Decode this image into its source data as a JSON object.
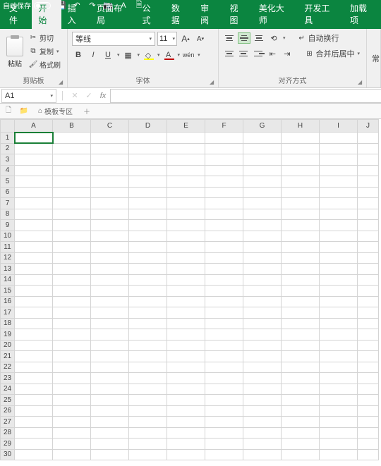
{
  "titlebar": {
    "autosave": "自动保存"
  },
  "tabs": [
    "文件",
    "开始",
    "插入",
    "页面布局",
    "公式",
    "数据",
    "审阅",
    "视图",
    "美化大师",
    "开发工具",
    "加载项"
  ],
  "active_tab": 1,
  "clipboard": {
    "paste": "粘贴",
    "cut": "剪切",
    "copy": "复制",
    "format_painter": "格式刷",
    "label": "剪贴板"
  },
  "font": {
    "name": "等线",
    "size": "11",
    "label": "字体",
    "buttons": {
      "bold": "B",
      "italic": "I",
      "underline": "U"
    }
  },
  "align": {
    "wrap": "自动换行",
    "merge": "合并后居中",
    "label": "对齐方式"
  },
  "number": {
    "general": "常"
  },
  "namebox": "A1",
  "sheet_tab": {
    "template": "模板专区"
  },
  "columns": [
    "A",
    "B",
    "C",
    "D",
    "E",
    "F",
    "G",
    "H",
    "I",
    "J"
  ],
  "rows": 30,
  "selected": {
    "r": 1,
    "c": "A"
  }
}
